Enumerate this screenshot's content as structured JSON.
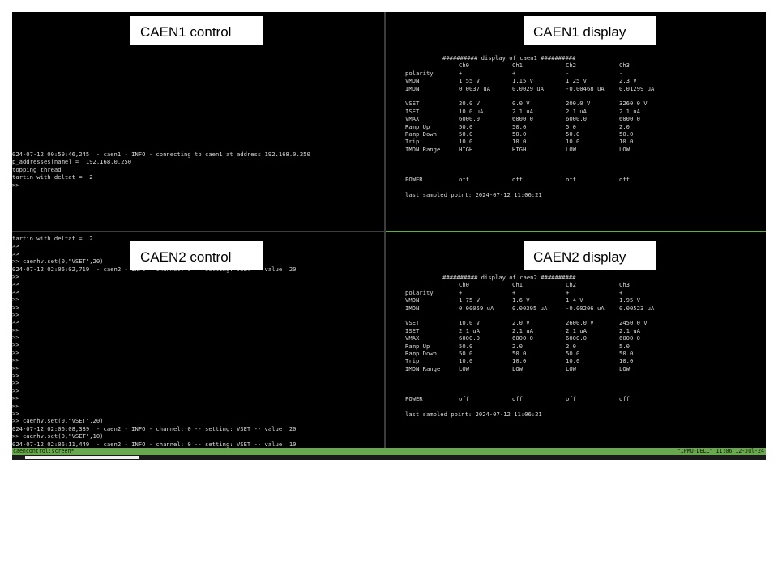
{
  "panes": {
    "caen1_control": {
      "label": "CAEN1 control",
      "lines": [
        "024-07-12 00:59:46,245  - caen1 - INFO - connecting to caen1 at address 192.168.0.250",
        "p_addresses[name] =  192.168.0.250",
        "topping thread",
        "tartin with deltat =  2",
        ">>"
      ]
    },
    "caen1_display": {
      "label": "CAEN1 display",
      "title": "########## display of caen1 ##########",
      "channels": [
        "Ch0",
        "Ch1",
        "Ch2",
        "Ch3"
      ],
      "rows": [
        {
          "name": "polarity",
          "values": [
            "+",
            "+",
            "-",
            "-"
          ]
        },
        {
          "name": "VMON",
          "values": [
            "1.55 V",
            "1.15 V",
            "1.25 V",
            "2.3 V"
          ]
        },
        {
          "name": "IMON",
          "values": [
            "0.0037 uA",
            "0.0029 uA",
            "-0.00468 uA",
            "0.01299 uA"
          ]
        },
        {
          "name": "VSET",
          "values": [
            "20.0 V",
            "0.0 V",
            "200.0 V",
            "3260.0 V"
          ]
        },
        {
          "name": "ISET",
          "values": [
            "10.0 uA",
            "2.1 uA",
            "2.1 uA",
            "2.1 uA"
          ]
        },
        {
          "name": "VMAX",
          "values": [
            "6000.0",
            "6000.0",
            "6000.0",
            "6000.0"
          ]
        },
        {
          "name": "Ramp Up",
          "values": [
            "50.0",
            "50.0",
            "5.0",
            "2.0"
          ]
        },
        {
          "name": "Ramp Down",
          "values": [
            "50.0",
            "50.0",
            "50.0",
            "50.0"
          ]
        },
        {
          "name": "Trip",
          "values": [
            "10.0",
            "10.0",
            "10.0",
            "10.0"
          ]
        },
        {
          "name": "IMON Range",
          "values": [
            "HIGH",
            "HIGH",
            "LOW",
            "LOW"
          ]
        }
      ],
      "power": {
        "name": "POWER",
        "values": [
          "off",
          "off",
          "off",
          "off"
        ]
      },
      "last_sampled": "last sampled point: 2024-07-12 11:06:21"
    },
    "caen2_control": {
      "label": "CAEN2 control",
      "lines": [
        "tartin with deltat =  2",
        ">>",
        ">>",
        ">> caenhv.set(0,\"VSET\",20)",
        "024-07-12 02:06:02,719  - caen2 - INFO - channel: 0 -- setting: VSET -- value: 20",
        ">>",
        ">>",
        ">>",
        ">>",
        ">>",
        ">>",
        ">>",
        ">>",
        ">>",
        ">>",
        ">>",
        ">>",
        ">>",
        ">>",
        ">>",
        ">>",
        ">>",
        ">>",
        ">>",
        ">> caenhv.set(0,\"VSET\",20)",
        "024-07-12 02:06:08,389  - caen2 - INFO - channel: 0 -- setting: VSET -- value: 20",
        ">> caenhv.set(0,\"VSET\",10)",
        "024-07-12 02:06:11,449  - caen2 - INFO - channel: 0 -- setting: VSET -- value: 10",
        ">> caenhv.set(0,\"VSET\",10)"
      ]
    },
    "caen2_display": {
      "label": "CAEN2 display",
      "title": "########## display of caen2 ##########",
      "channels": [
        "Ch0",
        "Ch1",
        "Ch2",
        "Ch3"
      ],
      "rows": [
        {
          "name": "polarity",
          "values": [
            "+",
            "+",
            "+",
            "+"
          ]
        },
        {
          "name": "VMON",
          "values": [
            "1.75 V",
            "1.6 V",
            "1.4 V",
            "1.95 V"
          ]
        },
        {
          "name": "IMON",
          "values": [
            "0.00059 uA",
            "0.00395 uA",
            "-0.00206 uA",
            "0.00523 uA"
          ]
        },
        {
          "name": "VSET",
          "values": [
            "10.0 V",
            "2.0 V",
            "2600.0 V",
            "2450.0 V"
          ]
        },
        {
          "name": "ISET",
          "values": [
            "2.1 uA",
            "2.1 uA",
            "2.1 uA",
            "2.1 uA"
          ]
        },
        {
          "name": "VMAX",
          "values": [
            "6000.0",
            "6000.0",
            "6000.0",
            "6000.0"
          ]
        },
        {
          "name": "Ramp Up",
          "values": [
            "50.0",
            "2.0",
            "2.0",
            "5.0"
          ]
        },
        {
          "name": "Ramp Down",
          "values": [
            "50.0",
            "50.0",
            "50.0",
            "50.0"
          ]
        },
        {
          "name": "Trip",
          "values": [
            "10.0",
            "10.0",
            "10.0",
            "10.0"
          ]
        },
        {
          "name": "IMON Range",
          "values": [
            "LOW",
            "LOW",
            "LOW",
            "LOW"
          ]
        }
      ],
      "power": {
        "name": "POWER",
        "values": [
          "off",
          "off",
          "off",
          "off"
        ]
      },
      "last_sampled": "last sampled point: 2024-07-12 11:06:21"
    }
  },
  "statusbar": {
    "left": "caencontrol:screen*",
    "right": "\"IPMU-DELL\" 11:06 12-Jul-24"
  },
  "colors": {
    "terminal_bg": "#000000",
    "terminal_fg": "#d8d8d8",
    "statusbar_bg": "#6aa84f",
    "label_bg": "#ffffff"
  }
}
